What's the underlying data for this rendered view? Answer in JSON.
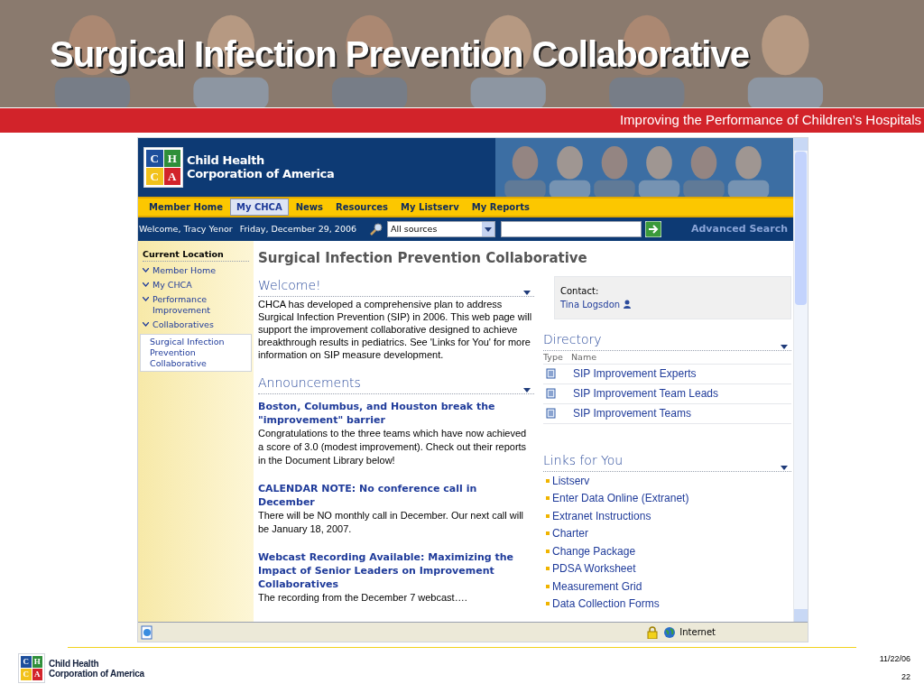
{
  "slide": {
    "title": "Surgical Infection Prevention Collaborative",
    "subtitle": "Improving the Performance of Children’s Hospitals"
  },
  "site": {
    "logo_letters": [
      "C",
      "H",
      "C",
      "A"
    ],
    "logo_lines": [
      "Child Health",
      "Corporation of America"
    ],
    "nav": [
      {
        "label": "Member Home",
        "selected": false
      },
      {
        "label": "My CHCA",
        "selected": true
      },
      {
        "label": "News",
        "selected": false
      },
      {
        "label": "Resources",
        "selected": false
      },
      {
        "label": "My Listserv",
        "selected": false
      },
      {
        "label": "My Reports",
        "selected": false
      }
    ],
    "welcome": "Welcome, Tracy Yenor",
    "date": "Friday, December 29, 2006",
    "search_scope": "All sources",
    "advanced_search": "Advanced Search",
    "sidebar": {
      "heading": "Current Location",
      "items": [
        {
          "label": "Member Home",
          "selected": false
        },
        {
          "label": "My CHCA",
          "selected": false
        },
        {
          "label": "Performance Improvement",
          "selected": false
        },
        {
          "label": "Collaboratives",
          "selected": false
        },
        {
          "label": "Surgical Infection Prevention Collaborative",
          "selected": true
        }
      ]
    },
    "page_title": "Surgical Infection Prevention Collaborative",
    "welcome_section": {
      "title": "Welcome!",
      "text": "CHCA has developed a comprehensive plan to address Surgical Infection Prevention (SIP) in 2006.  This web page will support the improvement collaborative designed to achieve breakthrough results in pediatrics. See 'Links for You' for more information on SIP measure development."
    },
    "announcements": {
      "title": "Announcements",
      "items": [
        {
          "headline": "Boston, Columbus, and Houston break the \"improvement\" barrier",
          "body": "Congratulations to the three teams which have now achieved a score of 3.0 (modest improvement). Check out their reports in the Document Library below!"
        },
        {
          "headline": "CALENDAR NOTE: No conference call in December",
          "body": "There will be NO monthly call in December. Our next call will be January 18, 2007."
        },
        {
          "headline": "Webcast Recording Available: Maximizing the Impact of Senior Leaders on Improvement Collaboratives",
          "body": "The recording from the December 7 webcast…."
        }
      ]
    },
    "contact": {
      "label": "Contact:",
      "name": "Tina Logsdon"
    },
    "directory": {
      "title": "Directory",
      "columns": [
        "Type",
        "Name"
      ],
      "rows": [
        "SIP Improvement Experts",
        "SIP Improvement Team Leads",
        "SIP Improvement Teams"
      ]
    },
    "links": {
      "title": "Links for You",
      "items": [
        "Listserv",
        "Enter Data Online (Extranet)",
        "Extranet Instructions",
        "Charter",
        "Change Package",
        "PDSA Worksheet",
        "Measurement Grid",
        "Data Collection Forms"
      ]
    }
  },
  "status_bar": {
    "zone": "Internet"
  },
  "footer": {
    "logo_letters": [
      "C",
      "H",
      "C",
      "A"
    ],
    "logo_lines": [
      "Child Health",
      "Corporation of America"
    ],
    "date": "11/22/06",
    "page": "22"
  }
}
